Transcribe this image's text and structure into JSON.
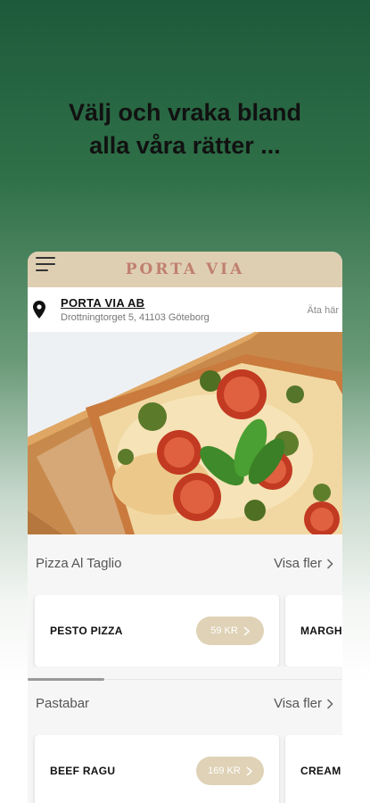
{
  "headline": {
    "line1": "Välj och vraka bland",
    "line2": "alla våra rätter ..."
  },
  "app": {
    "brand": "PORTA VIA",
    "store": {
      "name": "PORTA VIA AB",
      "address": "Drottningtorget 5, 41103 Göteborg",
      "mode": "Äta här"
    },
    "sections": [
      {
        "title": "Pizza Al Taglio",
        "see_more": "Visa fler",
        "items": [
          {
            "name": "PESTO PIZZA",
            "price": "59 KR"
          },
          {
            "name": "MARGH",
            "price": ""
          }
        ]
      },
      {
        "title": "Pastabar",
        "see_more": "Visa fler",
        "items": [
          {
            "name": "BEEF RAGU",
            "price": "169 KR"
          },
          {
            "name": "CREAM",
            "price": ""
          }
        ]
      }
    ]
  },
  "colors": {
    "brand_text": "#c0806f",
    "topbar_bg": "#dfcfb2",
    "price_pill": "#dfd2b6",
    "background_top": "#1d5a3b"
  },
  "icons": {
    "menu": "hamburger-menu-icon",
    "location": "location-pin-icon",
    "chevron": "chevron-right-icon"
  }
}
